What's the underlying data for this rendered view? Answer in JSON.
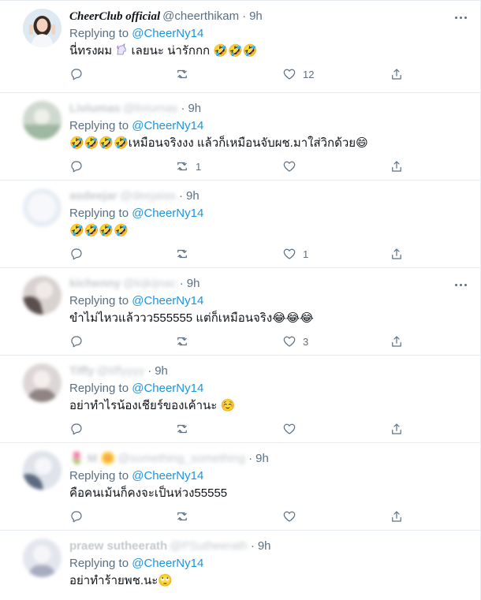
{
  "colors": {
    "accent": "#1b95e0",
    "muted": "#5b7083",
    "border": "#e6ecf0",
    "text": "#0f1419"
  },
  "tweets": [
    {
      "name": "CheerClub official",
      "handle": "@cheerthikam",
      "time": "9h",
      "replying_label": "Replying to",
      "mention": "@CheerNy14",
      "text_before": "นี่ทรงผม",
      "text_after": "เลยนะ น่ารักกก",
      "emoji": "🤣🤣🤣",
      "reply_count": "",
      "retweet_count": "",
      "like_count": "12"
    },
    {
      "name": "Liviumas",
      "handle": "@liviumas",
      "time": "9h",
      "replying_label": "Replying to",
      "mention": "@CheerNy14",
      "text": "🤣🤣🤣🤣เหมือนจริงงง แล้วก็เหมือนจับผช.มาใส่วิกด้วย😄",
      "reply_count": "",
      "retweet_count": "1",
      "like_count": ""
    },
    {
      "name": "asdeejar",
      "handle": "@deejaias",
      "time": "9h",
      "replying_label": "Replying to",
      "mention": "@CheerNy14",
      "text": "🤣🤣🤣🤣",
      "reply_count": "",
      "retweet_count": "",
      "like_count": "1"
    },
    {
      "name": "kichenny",
      "handle": "@kijkijnac",
      "time": "9h",
      "replying_label": "Replying to",
      "mention": "@CheerNy14",
      "text": "ขำไม่ไหวแล้ววว555555 แต่ก็เหมือนจริง😂😂😂",
      "reply_count": "",
      "retweet_count": "",
      "like_count": "3"
    },
    {
      "name": "Tiffy",
      "handle": "@tiffyyyy",
      "time": "9h",
      "replying_label": "Replying to",
      "mention": "@CheerNy14",
      "text": "อย่าทำไรน้องเชียร์ของเค้านะ ☺️",
      "reply_count": "",
      "retweet_count": "",
      "like_count": ""
    },
    {
      "name": "🌷 M 🌼",
      "handle": "@something_something",
      "time": "9h",
      "replying_label": "Replying to",
      "mention": "@CheerNy14",
      "text": "คือคนเม้นก็คงจะเป็นห่วง55555",
      "reply_count": "",
      "retweet_count": "",
      "like_count": ""
    },
    {
      "name": "praew sutheerath",
      "handle": "@PSutheerath",
      "time": "9h",
      "replying_label": "Replying to",
      "mention": "@CheerNy14",
      "text": "อย่าทำร้ายพช.นะ🙄",
      "reply_count": "",
      "retweet_count": "",
      "like_count": ""
    }
  ]
}
